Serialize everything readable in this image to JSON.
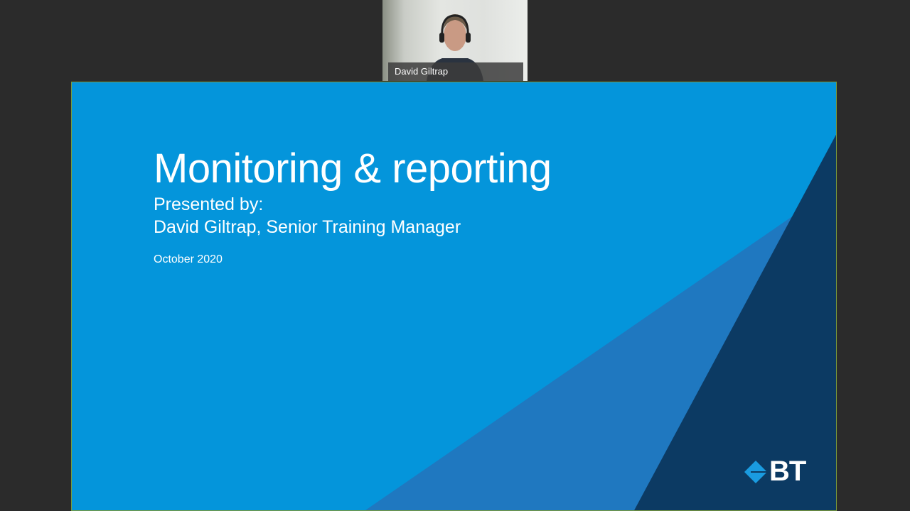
{
  "video": {
    "participant_name": "David Giltrap"
  },
  "slide": {
    "title": "Monitoring & reporting",
    "presented_by": "Presented by:",
    "presenter": "David Giltrap, Senior Training Manager",
    "date": "October 2020",
    "logo_text": "BT",
    "colors": {
      "background": "#0495db",
      "mid": "#1f78c0",
      "dark": "#0c3a63"
    }
  }
}
